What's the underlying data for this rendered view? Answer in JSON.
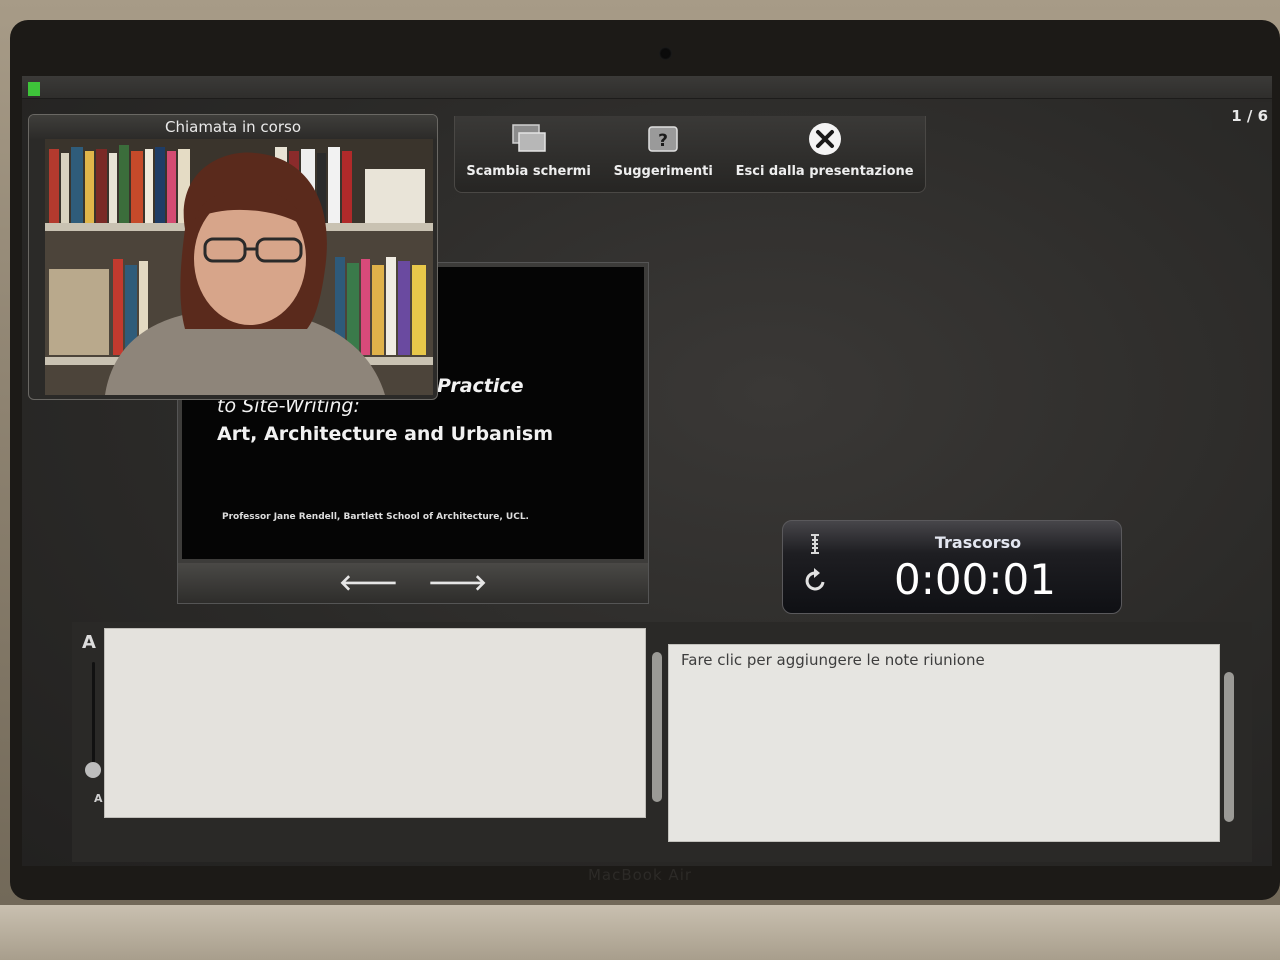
{
  "device": {
    "brand_text": "MacBook Air"
  },
  "presenter": {
    "slide_counter": "1 / 6",
    "toolbar": {
      "swap_screens_label": "Scambia schermi",
      "tips_label": "Suggerimenti",
      "exit_label": "Esci dalla presentazione"
    },
    "call": {
      "title": "Chiamata in corso"
    },
    "slide": {
      "line1": "Practice",
      "line2": "to Site-Writing:",
      "line3": "Art, Architecture and Urbanism",
      "credit": "Professor Jane Rendell, Bartlett School of Architecture, UCL."
    },
    "nav": {
      "prev": "🡐",
      "next": "🡒"
    },
    "timer": {
      "label": "Trascorso",
      "value": "0:00:01"
    },
    "notes": {
      "font_large": "A",
      "font_small": "A",
      "meeting_notes_placeholder": "Fare clic per aggiungere le note riunione"
    }
  }
}
